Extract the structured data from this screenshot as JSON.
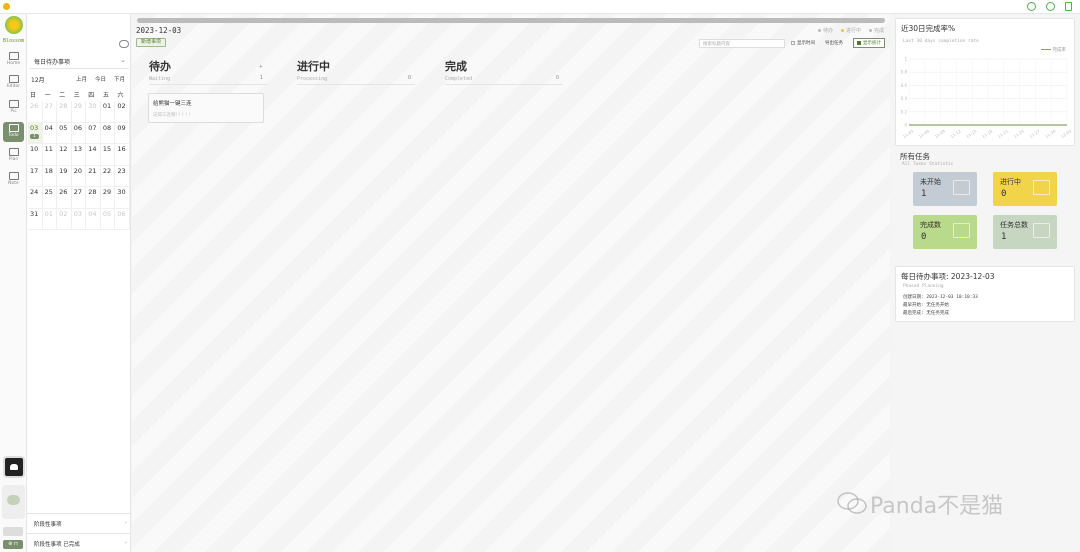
{
  "sidebar": {
    "logo_text": "Blossom",
    "items": [
      {
        "label": "Home",
        "icon": "home-icon"
      },
      {
        "label": "Editor",
        "icon": "editor-icon"
      },
      {
        "label": "Pic",
        "icon": "picture-icon"
      },
      {
        "label": "Todo",
        "icon": "todo-icon",
        "active": true
      },
      {
        "label": "Plan",
        "icon": "plan-icon"
      },
      {
        "label": "Note",
        "icon": "note-icon"
      }
    ],
    "footer_label": "⊕ ⊓"
  },
  "calendar": {
    "dropdown_label": "每日待办事项",
    "month_label": "12月",
    "nav_prev": "上月",
    "nav_today": "今日",
    "nav_next": "下月",
    "weekdays": [
      "日",
      "一",
      "二",
      "三",
      "四",
      "五",
      "六"
    ],
    "days": [
      {
        "d": "26",
        "dim": true
      },
      {
        "d": "27",
        "dim": true
      },
      {
        "d": "28",
        "dim": true
      },
      {
        "d": "29",
        "dim": true
      },
      {
        "d": "30",
        "dim": true
      },
      {
        "d": "01"
      },
      {
        "d": "02"
      },
      {
        "d": "03",
        "today": true,
        "badge": "1"
      },
      {
        "d": "04"
      },
      {
        "d": "05"
      },
      {
        "d": "06"
      },
      {
        "d": "07"
      },
      {
        "d": "08"
      },
      {
        "d": "09"
      },
      {
        "d": "10"
      },
      {
        "d": "11"
      },
      {
        "d": "12"
      },
      {
        "d": "13"
      },
      {
        "d": "14"
      },
      {
        "d": "15"
      },
      {
        "d": "16"
      },
      {
        "d": "17"
      },
      {
        "d": "18"
      },
      {
        "d": "19"
      },
      {
        "d": "20"
      },
      {
        "d": "21"
      },
      {
        "d": "22"
      },
      {
        "d": "23"
      },
      {
        "d": "24"
      },
      {
        "d": "25"
      },
      {
        "d": "26"
      },
      {
        "d": "27"
      },
      {
        "d": "28"
      },
      {
        "d": "29"
      },
      {
        "d": "30"
      },
      {
        "d": "31"
      },
      {
        "d": "01",
        "dim": true
      },
      {
        "d": "02",
        "dim": true
      },
      {
        "d": "03",
        "dim": true
      },
      {
        "d": "04",
        "dim": true
      },
      {
        "d": "05",
        "dim": true
      },
      {
        "d": "06",
        "dim": true
      }
    ],
    "footer_items": [
      "阶段性事项",
      "阶段性事项 已完成"
    ]
  },
  "main": {
    "date": "2023-12-03",
    "add_button": "新增事项",
    "legend": [
      {
        "label": "待办",
        "color": "#bbbbbb"
      },
      {
        "label": "进行中",
        "color": "#f0c040"
      },
      {
        "label": "完成",
        "color": "#bbbbbb"
      }
    ],
    "search_placeholder": "搜索标题内容",
    "show_time_label": "显示时间",
    "export_label": "导出任务",
    "show_stats_label": "显示统计",
    "columns": [
      {
        "title": "待办",
        "subtitle": "Waiting",
        "count": "1",
        "plus": "+"
      },
      {
        "title": "进行中",
        "subtitle": "Processing",
        "count": "0"
      },
      {
        "title": "完成",
        "subtitle": "Completed",
        "count": "0"
      }
    ],
    "task": {
      "title": "给熊猫一键三连",
      "meta": "记得三连啊! ! ! ! !"
    }
  },
  "right": {
    "chart_title": "近30日完成率%",
    "chart_subtitle": "Last 30 days completion rate",
    "chart_legend": "完成率",
    "stats_title": "所有任务",
    "stats_subtitle": "All Tasks Statistic",
    "stats": [
      {
        "label": "未开始",
        "value": "1",
        "color": "#c3ccd4"
      },
      {
        "label": "进行中",
        "value": "0",
        "color": "#f2d44a"
      },
      {
        "label": "完成数",
        "value": "0",
        "color": "#b9d98b"
      },
      {
        "label": "任务总数",
        "value": "1",
        "color": "#c7d6c0"
      }
    ],
    "info_title": "每日待办事项: 2023-12-03",
    "info_subtitle": "Phased Planning",
    "info_rows": [
      "创建日期: 2023-12-03 10:10:33",
      "最早开始: 无任务开始",
      "最后完成: 无任务完成"
    ]
  },
  "chart_data": {
    "type": "line",
    "title": "近30日完成率%",
    "x": [
      "11-03",
      "11-06",
      "11-09",
      "11-12",
      "11-15",
      "11-18",
      "11-21",
      "11-24",
      "11-27",
      "11-30",
      "12-03"
    ],
    "series": [
      {
        "name": "完成率",
        "values": [
          0,
          0,
          0,
          0,
          0,
          0,
          0,
          0,
          0,
          0,
          0
        ]
      }
    ],
    "yticks": [
      "0",
      "0.2",
      "0.4",
      "0.6",
      "0.8",
      "1"
    ],
    "ylim": [
      0,
      1
    ],
    "grid": true,
    "legend_position": "top-right",
    "color": "#8aa36b"
  },
  "watermark": "Panda不是猫"
}
